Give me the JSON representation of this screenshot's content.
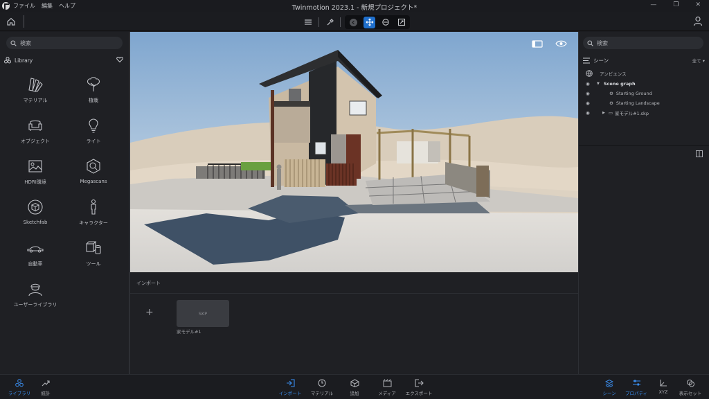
{
  "titlebar": {
    "menu": [
      "ファイル",
      "編集",
      "ヘルプ"
    ],
    "title": "Twinmotion 2023.1 - 新規プロジェクト*"
  },
  "library": {
    "search_placeholder": "検索",
    "header": "Library",
    "items": [
      {
        "label": "マテリアル",
        "icon": "material-icon"
      },
      {
        "label": "植栽",
        "icon": "tree-icon"
      },
      {
        "label": "オブジェクト",
        "icon": "sofa-icon"
      },
      {
        "label": "ライト",
        "icon": "bulb-icon"
      },
      {
        "label": "HDRI環境",
        "icon": "image-icon"
      },
      {
        "label": "Megascans",
        "icon": "megascans-icon"
      },
      {
        "label": "Sketchfab",
        "icon": "sketchfab-icon"
      },
      {
        "label": "キャラクター",
        "icon": "person-icon"
      },
      {
        "label": "自動車",
        "icon": "car-icon"
      },
      {
        "label": "ツール",
        "icon": "cubes-icon"
      },
      {
        "label": "ユーザーライブラリ",
        "icon": "user-library-icon"
      }
    ]
  },
  "import_panel": {
    "header": "インポート",
    "thumb_text": "SKP",
    "thumb_label": "家モデル#1"
  },
  "scene": {
    "search_placeholder": "検索",
    "header": "シーン",
    "filter": "全て",
    "rows": [
      {
        "label": "アンビエンス"
      },
      {
        "label": "Scene graph"
      },
      {
        "label": "Starting Ground"
      },
      {
        "label": "Starting Landscape"
      },
      {
        "label": "家モデル#1.skp"
      }
    ]
  },
  "bottombar": {
    "left": [
      {
        "label": "ライブラリ",
        "active": true
      },
      {
        "label": "統計",
        "active": false
      }
    ],
    "center": [
      {
        "label": "インポート",
        "active": true
      },
      {
        "label": "マテリアル",
        "active": false
      },
      {
        "label": "追加",
        "active": false
      },
      {
        "label": "メディア",
        "active": false
      },
      {
        "label": "エクスポート",
        "active": false
      }
    ],
    "right": [
      {
        "label": "シーン",
        "active": true
      },
      {
        "label": "プロパティ",
        "active": true
      },
      {
        "label": "XYZ",
        "active": false
      },
      {
        "label": "表示セット",
        "active": false
      }
    ]
  },
  "colors": {
    "accent": "#1f6fcc",
    "active_text": "#3a8ef0",
    "panel_bg": "#1f2024"
  }
}
